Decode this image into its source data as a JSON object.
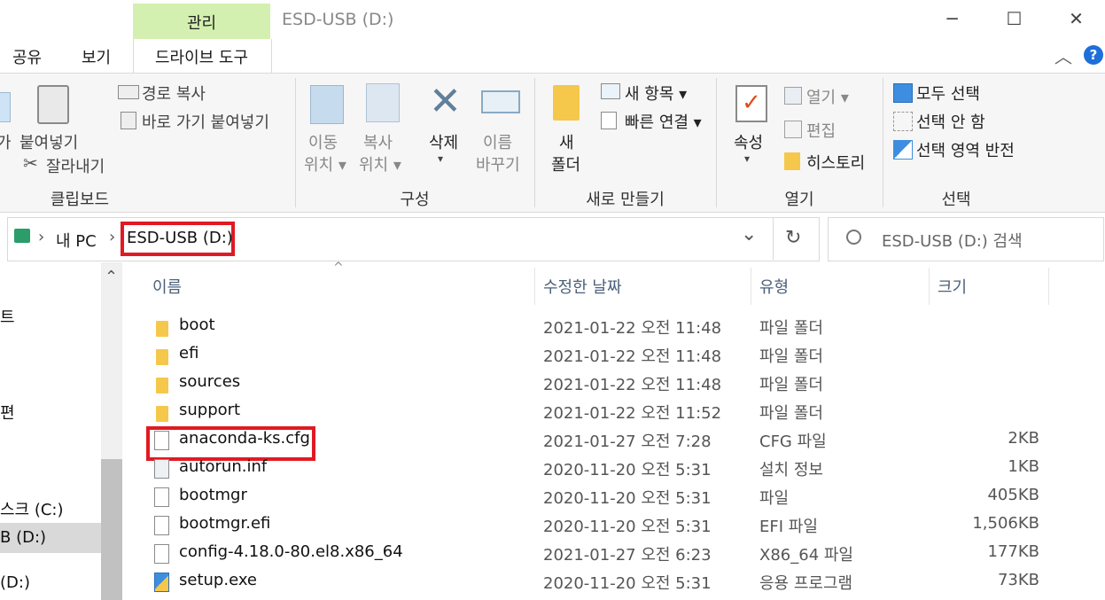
{
  "window": {
    "title": "ESD-USB (D:)",
    "context_tab": "관리",
    "tabs": [
      "공유",
      "보기",
      "드라이브 도구"
    ],
    "controls": {
      "minimize": "─",
      "maximize": "☐",
      "close": "✕"
    },
    "collapse_ribbon": "︿",
    "help": "?"
  },
  "ribbon": {
    "clipboard": {
      "group_label": "클립보드",
      "paste": "붙여넣기",
      "cut": "잘라내기",
      "copy_path": "경로 복사",
      "paste_shortcut": "바로 가기 붙여넣기"
    },
    "organize": {
      "group_label": "구성",
      "move_to": [
        "이동",
        "위치 ▾"
      ],
      "copy_to": [
        "복사",
        "위치 ▾"
      ],
      "delete": [
        "삭제",
        "▾"
      ],
      "rename": [
        "이름",
        "바꾸기"
      ]
    },
    "new": {
      "group_label": "새로 만들기",
      "new_folder": [
        "새",
        "폴더"
      ],
      "new_item": "새 항목 ▾",
      "easy_access": "빠른 연결 ▾"
    },
    "open": {
      "group_label": "열기",
      "properties": [
        "속성",
        "▾"
      ],
      "open": "열기 ▾",
      "edit": "편집",
      "history": "히스토리"
    },
    "select": {
      "group_label": "선택",
      "select_all": "모두 선택",
      "select_none": "선택 안 함",
      "invert": "선택 영역 반전"
    }
  },
  "address": {
    "root": "내 PC",
    "sep": "›",
    "current": "ESD-USB (D:)",
    "dropdown": "⌄",
    "refresh": "↻"
  },
  "search": {
    "placeholder": "ESD-USB (D:) 검색"
  },
  "columns": {
    "name": "이름",
    "date": "수정한 날짜",
    "type": "유형",
    "size": "크기"
  },
  "sort_indicator": "^",
  "files": [
    {
      "name": "boot",
      "date": "2021-01-22 오전 11:48",
      "type": "파일 폴더",
      "size": "",
      "kind": "folder"
    },
    {
      "name": "efi",
      "date": "2021-01-22 오전 11:48",
      "type": "파일 폴더",
      "size": "",
      "kind": "folder"
    },
    {
      "name": "sources",
      "date": "2021-01-22 오전 11:48",
      "type": "파일 폴더",
      "size": "",
      "kind": "folder"
    },
    {
      "name": "support",
      "date": "2021-01-22 오전 11:52",
      "type": "파일 폴더",
      "size": "",
      "kind": "folder"
    },
    {
      "name": "anaconda-ks.cfg",
      "date": "2021-01-27 오전 7:28",
      "type": "CFG 파일",
      "size": "2KB",
      "kind": "file"
    },
    {
      "name": "autorun.inf",
      "date": "2020-11-20 오전 5:31",
      "type": "설치 정보",
      "size": "1KB",
      "kind": "file"
    },
    {
      "name": "bootmgr",
      "date": "2020-11-20 오전 5:31",
      "type": "파일",
      "size": "405KB",
      "kind": "file"
    },
    {
      "name": "bootmgr.efi",
      "date": "2020-11-20 오전 5:31",
      "type": "EFI 파일",
      "size": "1,506KB",
      "kind": "file"
    },
    {
      "name": "config-4.18.0-80.el8.x86_64",
      "date": "2021-01-27 오전 6:23",
      "type": "X86_64 파일",
      "size": "177KB",
      "kind": "file"
    },
    {
      "name": "setup.exe",
      "date": "2020-11-20 오전 5:31",
      "type": "응용 프로그램",
      "size": "73KB",
      "kind": "exe"
    }
  ],
  "nav_pane": {
    "items": [
      "트",
      "편",
      "스크 (C:)",
      "B (D:)",
      "(D:)"
    ],
    "scroll_up": "⌃"
  },
  "colors": {
    "manage_tab": "#d4f0b0",
    "highlight_box": "#e01a22",
    "folder": "#f5c84c",
    "help": "#1e6fd9"
  }
}
